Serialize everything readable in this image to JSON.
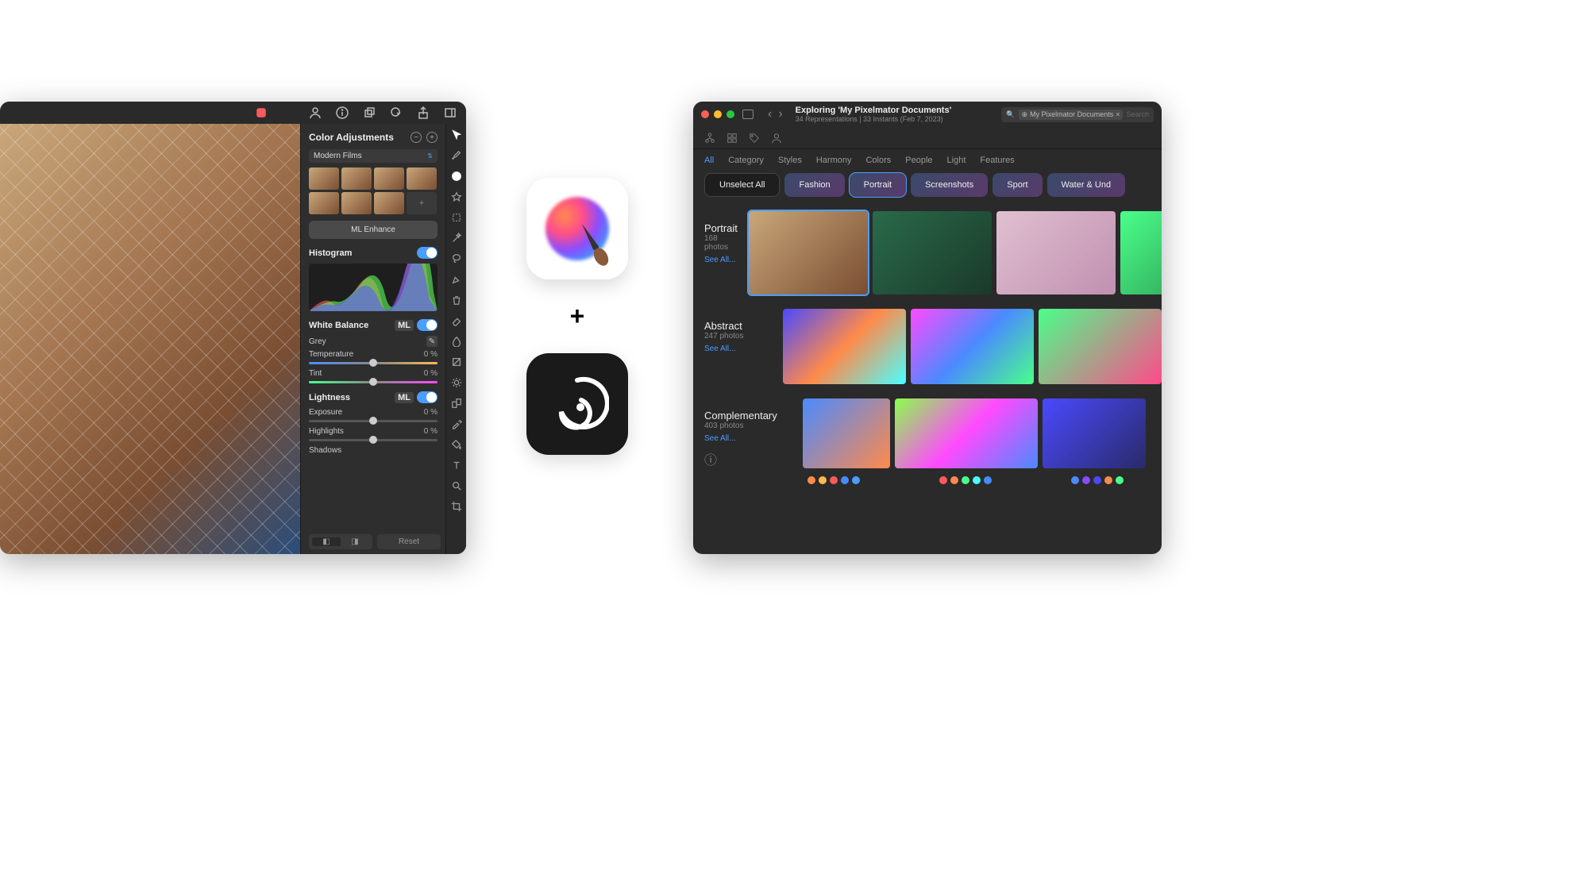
{
  "pixelmator": {
    "panel_title": "Color Adjustments",
    "preset_name": "Modern Films",
    "ml_enhance": "ML Enhance",
    "ml_badge": "ML",
    "sections": {
      "histogram": "Histogram",
      "white_balance": "White Balance",
      "lightness": "Lightness"
    },
    "white_balance": {
      "mode": "Grey",
      "temperature_label": "Temperature",
      "temperature_value": "0 %",
      "tint_label": "Tint",
      "tint_value": "0 %"
    },
    "lightness": {
      "exposure_label": "Exposure",
      "exposure_value": "0 %",
      "highlights_label": "Highlights",
      "highlights_value": "0 %",
      "shadows_label": "Shadows"
    },
    "footer": {
      "reset": "Reset"
    }
  },
  "center": {
    "plus": "+"
  },
  "browser": {
    "title": "Exploring 'My Pixelmator Documents'",
    "subtitle": "34 Representations | 33 Instants (Feb 7, 2023)",
    "search_token": "My Pixelmator Documents",
    "search_placeholder": "Search",
    "tabs": [
      "All",
      "Category",
      "Styles",
      "Harmony",
      "Colors",
      "People",
      "Light",
      "Features"
    ],
    "chips": {
      "unselect": "Unselect All",
      "items": [
        "Fashion",
        "Portrait",
        "Screenshots",
        "Sport",
        "Water & Und"
      ]
    },
    "sections": [
      {
        "name": "Portrait",
        "count": "168 photos",
        "link": "See All..."
      },
      {
        "name": "Abstract",
        "count": "247 photos",
        "link": "See All..."
      },
      {
        "name": "Complementary",
        "count": "403 photos",
        "link": "See All..."
      }
    ],
    "dot_colors_1": [
      "#ff8a4d",
      "#ffb84d",
      "#ff5a5a",
      "#4a8aff",
      "#4a9eff"
    ],
    "dot_colors_2": [
      "#ff5a5a",
      "#ff8a4d",
      "#4aff8a",
      "#4affff",
      "#4a8aff"
    ],
    "dot_colors_3": [
      "#4a8aff",
      "#8a4aff",
      "#4a4aff",
      "#ff8a4d",
      "#4aff8a"
    ]
  }
}
